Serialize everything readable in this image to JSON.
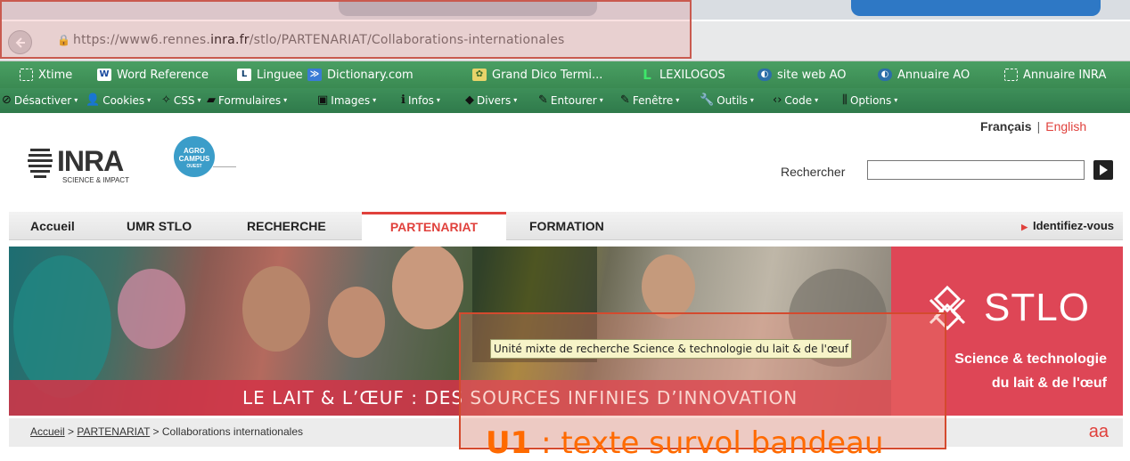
{
  "browser": {
    "url_prefix": "https://www6.rennes.",
    "url_domain": "inra.fr",
    "url_path": "/stlo/PARTENARIAT/Collaborations-internationales"
  },
  "bookmarks": [
    {
      "label": "Xtime",
      "icon": "dotted-square-icon"
    },
    {
      "label": "Word Reference",
      "icon": "wordreference-icon"
    },
    {
      "label": "Linguee",
      "icon": "linguee-icon"
    },
    {
      "label": "Dictionary.com",
      "icon": "dictionary-icon"
    },
    {
      "label": "Grand Dico Termi...",
      "icon": "grand-dico-icon"
    },
    {
      "label": "LEXILOGOS",
      "icon": "lexilogos-icon"
    },
    {
      "label": "site web AO",
      "icon": "site-web-icon"
    },
    {
      "label": "Annuaire AO",
      "icon": "annuaire-icon"
    },
    {
      "label": "Annuaire INRA",
      "icon": "dotted-square-icon"
    }
  ],
  "toolbar": [
    {
      "label": "Désactiver",
      "glyph": "⃠"
    },
    {
      "label": "Cookies",
      "glyph": "●"
    },
    {
      "label": "CSS",
      "glyph": "✎"
    },
    {
      "label": "Formulaires",
      "glyph": "▬"
    },
    {
      "label": "Images",
      "glyph": "▭"
    },
    {
      "label": "Infos",
      "glyph": "ℹ"
    },
    {
      "label": "Divers",
      "glyph": "◆"
    },
    {
      "label": "Entourer",
      "glyph": "╱"
    },
    {
      "label": "Fenêtre",
      "glyph": "╱"
    },
    {
      "label": "Outils",
      "glyph": "⚒"
    },
    {
      "label": "Code",
      "glyph": "‹›"
    },
    {
      "label": "Options",
      "glyph": "⫼"
    }
  ],
  "header": {
    "lang_fr": "Français",
    "lang_sep": "|",
    "lang_en": "English",
    "inra_logo": "INRA",
    "inra_tagline": "SCIENCE & IMPACT",
    "agro_logo_line1": "AGRO",
    "agro_logo_line2": "CAMPUS",
    "agro_logo_line3": "OUEST",
    "search_label": "Rechercher",
    "search_value": ""
  },
  "nav": {
    "items": [
      "Accueil",
      "UMR STLO",
      "RECHERCHE",
      "PARTENARIAT",
      "FORMATION"
    ],
    "active": "PARTENARIAT",
    "identify": "Identifiez-vous"
  },
  "banner": {
    "slogan": "LE LAIT & L’ŒUF : DES SOURCES INFINIES D’INNOVATION",
    "title": "STLO",
    "subtitle_line1": "Science & technologie",
    "subtitle_line2": "du lait & de l'œuf"
  },
  "breadcrumb": {
    "home": "Accueil",
    "sep": ">",
    "section": "PARTENARIAT",
    "current": "Collaborations internationales",
    "font_size_control": "aa"
  },
  "annotation": {
    "tooltip": "Unité mixte de recherche Science & technologie du lait & de l'œuf",
    "label_bold": "U1",
    "label_rest": " : texte survol bandeau"
  },
  "colors": {
    "accent_red": "#e0413c",
    "bookmark_green": "#3a8a52",
    "banner_red": "#de4656",
    "annotation_orange": "#ff6a00"
  }
}
